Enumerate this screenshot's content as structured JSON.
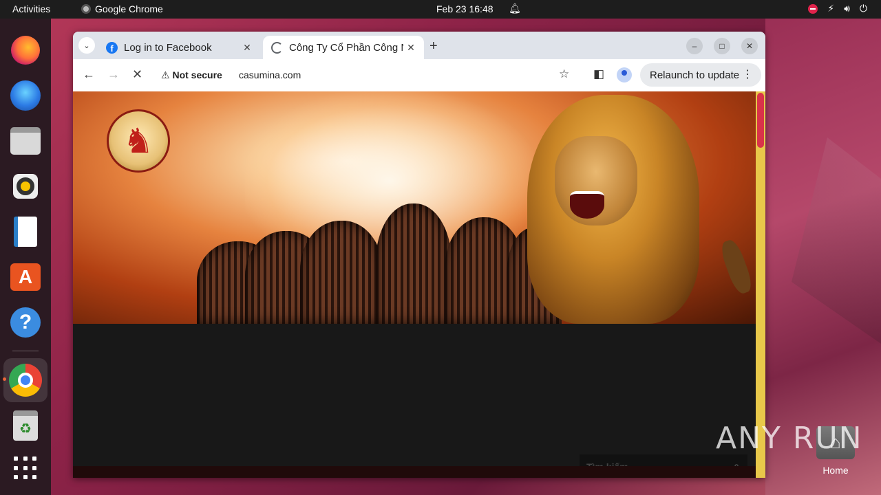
{
  "topbar": {
    "activities": "Activities",
    "app_name": "Google Chrome",
    "clock": "Feb 23  16:48"
  },
  "dock": {
    "items": [
      "Firefox",
      "Thunderbird",
      "Files",
      "Rhythmbox",
      "LibreOffice Writer",
      "Ubuntu Software",
      "Help",
      "Google Chrome",
      "Trash",
      "Show Applications"
    ]
  },
  "desktop": {
    "home_label": "Home",
    "watermark": "ANY RUN"
  },
  "browser": {
    "tabs": [
      {
        "title": "Log in to Facebook",
        "icon": "facebook-icon"
      },
      {
        "title": "Công Ty Cổ Phần Công N",
        "icon": "loading-icon"
      }
    ],
    "security_label": "Not secure",
    "url": "casumina.com",
    "relaunch_label": "Relaunch to update"
  },
  "page": {
    "search_placeholder": "Tìm kiếm"
  }
}
